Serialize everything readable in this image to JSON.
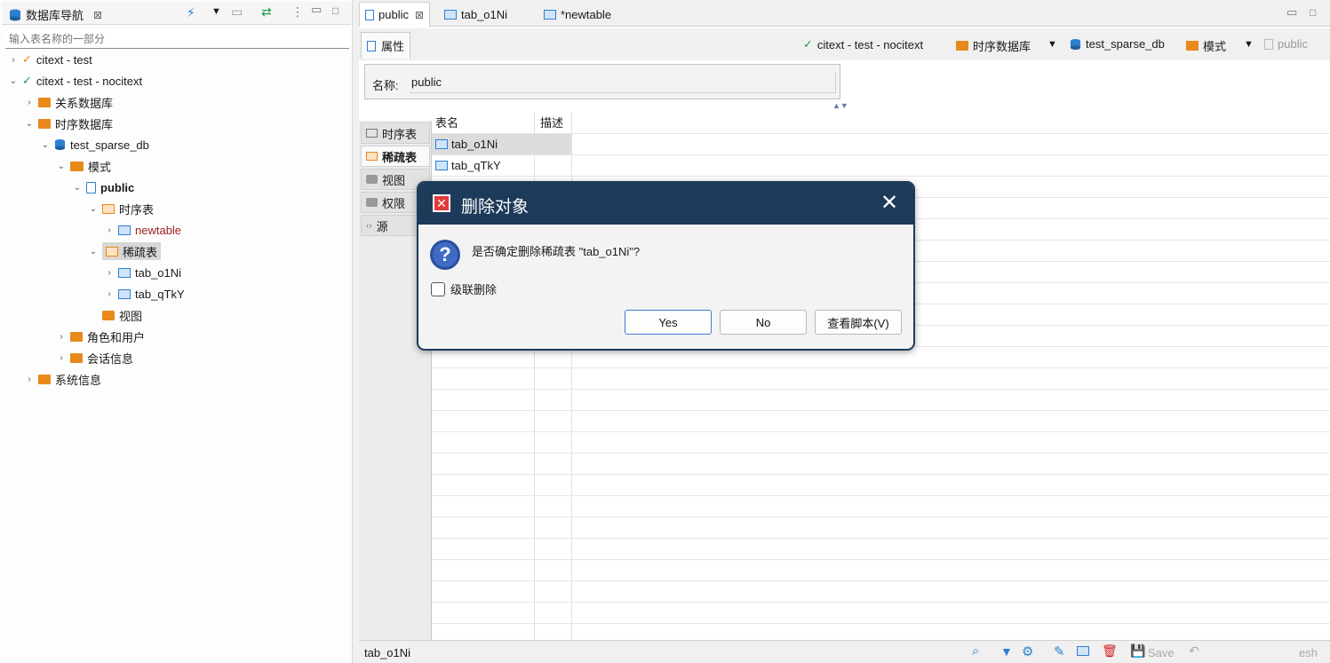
{
  "left_panel": {
    "title": "数据库导航",
    "filter_placeholder": "输入表名称的一部分",
    "tree": {
      "conn1": "citext - test",
      "conn2": "citext - test - nocitext",
      "relational_db": "关系数据库",
      "timeseries_db": "时序数据库",
      "test_db": "test_sparse_db",
      "schemas": "模式",
      "public": "public",
      "timeseries_tables": "时序表",
      "newtable": "newtable",
      "sparse_tables": "稀疏表",
      "tab1": "tab_o1Ni",
      "tab2": "tab_qTkY",
      "views": "视图",
      "roles": "角色和用户",
      "sessions": "会话信息",
      "system_info": "系统信息"
    }
  },
  "editor_tabs": [
    "public",
    "tab_o1Ni",
    "*newtable"
  ],
  "subbar": {
    "properties": "属性",
    "crumbs": {
      "conn": "citext - test - nocitext",
      "db_type": "时序数据库",
      "db": "test_sparse_db",
      "schemas": "模式",
      "schema": "public"
    }
  },
  "name_field": {
    "label": "名称:",
    "value": "public"
  },
  "side_tabs": [
    "时序表",
    "稀疏表",
    "视图",
    "权限",
    "源"
  ],
  "table": {
    "headers": {
      "name": "表名",
      "desc": "描述"
    },
    "rows": [
      "tab_o1Ni",
      "tab_qTkY"
    ]
  },
  "status": {
    "selected": "tab_o1Ni",
    "save": "Save",
    "refresh_partial": "esh"
  },
  "dialog": {
    "title": "删除对象",
    "message": "是否确定删除稀疏表 \"tab_o1Ni\"?",
    "cascade": "级联删除",
    "yes": "Yes",
    "no": "No",
    "script": "查看脚本(V)"
  },
  "colors": {
    "dialog_title": "#1e3a5a",
    "folder_orange": "#e8891c",
    "table_blue": "#2d7fd0",
    "red_text": "#a02020"
  }
}
